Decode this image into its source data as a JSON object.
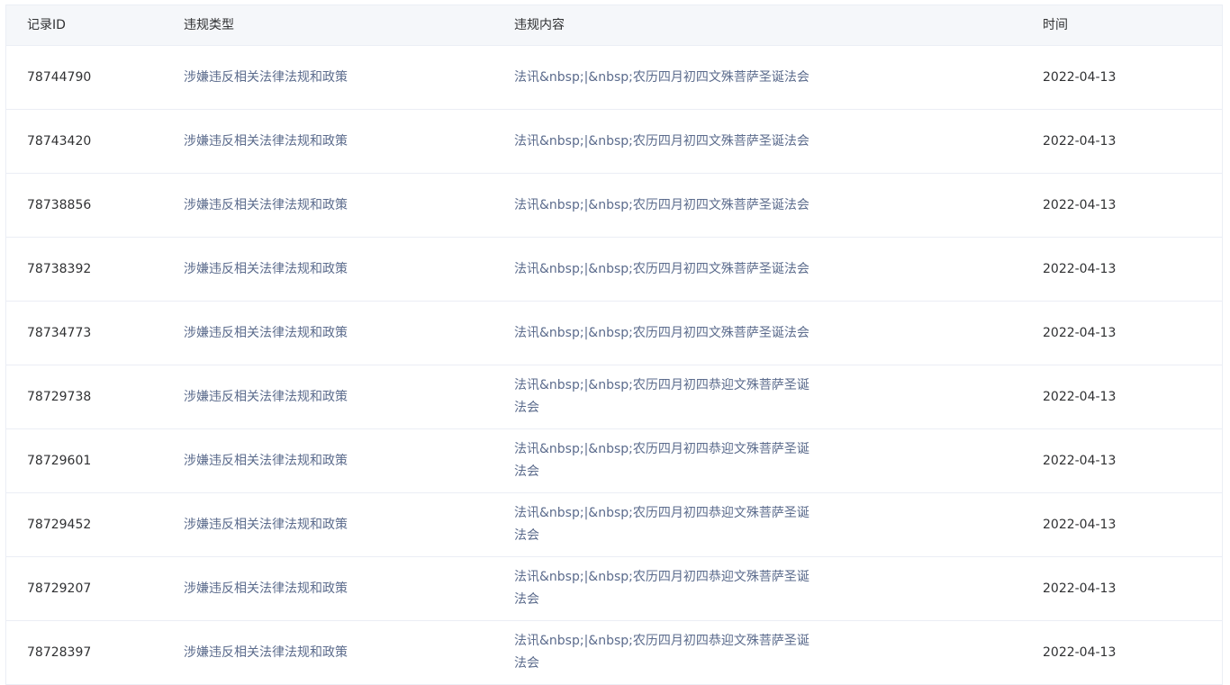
{
  "table": {
    "columns": {
      "id": "记录ID",
      "type": "违规类型",
      "content": "违规内容",
      "time": "时间"
    },
    "rows": [
      {
        "id": "78744790",
        "type": "涉嫌违反相关法律法规和政策",
        "content": "法讯&nbsp;|&nbsp;农历四月初四文殊菩萨圣诞法会",
        "time": "2022-04-13"
      },
      {
        "id": "78743420",
        "type": "涉嫌违反相关法律法规和政策",
        "content": "法讯&nbsp;|&nbsp;农历四月初四文殊菩萨圣诞法会",
        "time": "2022-04-13"
      },
      {
        "id": "78738856",
        "type": "涉嫌违反相关法律法规和政策",
        "content": "法讯&nbsp;|&nbsp;农历四月初四文殊菩萨圣诞法会",
        "time": "2022-04-13"
      },
      {
        "id": "78738392",
        "type": "涉嫌违反相关法律法规和政策",
        "content": "法讯&nbsp;|&nbsp;农历四月初四文殊菩萨圣诞法会",
        "time": "2022-04-13"
      },
      {
        "id": "78734773",
        "type": "涉嫌违反相关法律法规和政策",
        "content": "法讯&nbsp;|&nbsp;农历四月初四文殊菩萨圣诞法会",
        "time": "2022-04-13"
      },
      {
        "id": "78729738",
        "type": "涉嫌违反相关法律法规和政策",
        "content": "法讯&nbsp;|&nbsp;农历四月初四恭迎文殊菩萨圣诞法会",
        "time": "2022-04-13"
      },
      {
        "id": "78729601",
        "type": "涉嫌违反相关法律法规和政策",
        "content": "法讯&nbsp;|&nbsp;农历四月初四恭迎文殊菩萨圣诞法会",
        "time": "2022-04-13"
      },
      {
        "id": "78729452",
        "type": "涉嫌违反相关法律法规和政策",
        "content": "法讯&nbsp;|&nbsp;农历四月初四恭迎文殊菩萨圣诞法会",
        "time": "2022-04-13"
      },
      {
        "id": "78729207",
        "type": "涉嫌违反相关法律法规和政策",
        "content": "法讯&nbsp;|&nbsp;农历四月初四恭迎文殊菩萨圣诞法会",
        "time": "2022-04-13"
      },
      {
        "id": "78728397",
        "type": "涉嫌违反相关法律法规和政策",
        "content": "法讯&nbsp;|&nbsp;农历四月初四恭迎文殊菩萨圣诞法会",
        "time": "2022-04-13"
      }
    ]
  },
  "colors": {
    "header_bg": "#f5f7fa",
    "border": "#ebeef5",
    "text": "#303133",
    "link": "#5b6b8c"
  }
}
